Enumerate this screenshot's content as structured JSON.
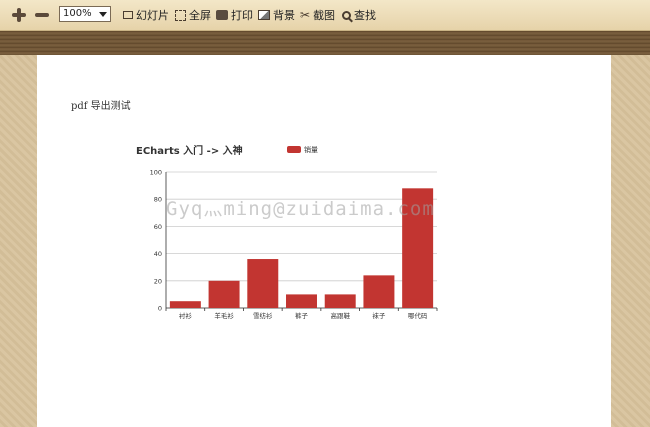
{
  "toolbar": {
    "zoom_value": "100%",
    "slideshow_label": "幻灯片",
    "fullscreen_label": "全屏",
    "print_label": "打印",
    "background_label": "背景",
    "screenshot_label": "截图",
    "find_label": "查找"
  },
  "document": {
    "title": "pdf  导出测试",
    "watermark": "Gyq灬ming@zuidaima.com"
  },
  "colors": {
    "bar": "#c23531",
    "toolbar_bg": "#efe1bf",
    "wood": "#6b5233"
  },
  "chart_data": {
    "type": "bar",
    "title": "ECharts 入门 -> 入神",
    "categories": [
      "衬衫",
      "羊毛衫",
      "雪纺衫",
      "裤子",
      "高跟鞋",
      "袜子",
      "哪代码"
    ],
    "series": [
      {
        "name": "销量",
        "values": [
          5,
          20,
          36,
          10,
          10,
          24,
          88
        ]
      }
    ],
    "ylim": [
      0,
      100
    ],
    "yticks": [
      0,
      20,
      40,
      60,
      80,
      100
    ],
    "grid": true,
    "legend": "top-center"
  }
}
